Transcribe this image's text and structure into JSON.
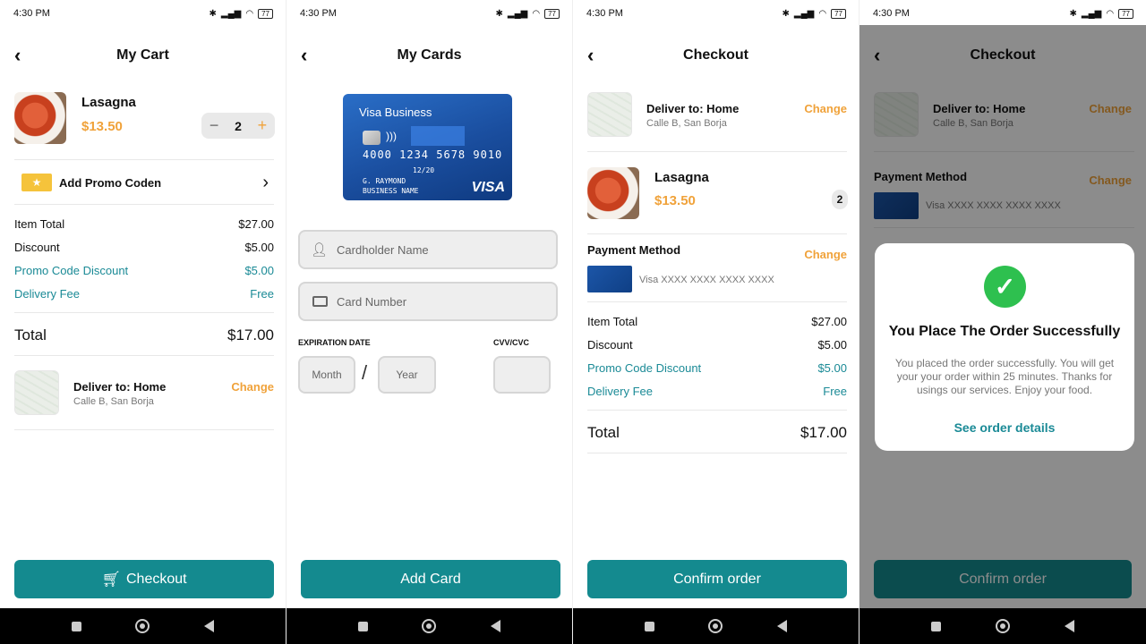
{
  "status": {
    "time": "4:30 PM",
    "battery": "77"
  },
  "cart": {
    "title": "My Cart",
    "item": {
      "name": "Lasagna",
      "price": "$13.50",
      "qty": "2"
    },
    "promo_label": "Add Promo Coden",
    "summary": [
      {
        "label": "Item Total",
        "value": "$27.00"
      },
      {
        "label": "Discount",
        "value": "$5.00"
      },
      {
        "label": "Promo Code Discount",
        "value": "$5.00"
      },
      {
        "label": "Delivery Fee",
        "value": "Free"
      }
    ],
    "total_label": "Total",
    "total_value": "$17.00",
    "deliver_title": "Deliver to: Home",
    "deliver_address": "Calle B, San Borja",
    "change": "Change",
    "checkout": "Checkout"
  },
  "cards": {
    "title": "My Cards",
    "card": {
      "brand_line": "Visa Business",
      "number": "4000 1234 5678 9010",
      "expiry": "12/20",
      "holder": "G. RAYMOND",
      "business": "BUSINESS NAME",
      "logo": "VISA"
    },
    "cardholder_placeholder": "Cardholder Name",
    "cardnumber_placeholder": "Card Number",
    "expiration_label": "EXPIRATION DATE",
    "cvv_label": "CVV/CVC",
    "month_placeholder": "Month",
    "year_placeholder": "Year",
    "slash": "/",
    "add_card": "Add Card"
  },
  "checkout": {
    "title": "Checkout",
    "deliver_title": "Deliver to: Home",
    "deliver_address": "Calle B, San Borja",
    "change": "Change",
    "item": {
      "name": "Lasagna",
      "price": "$13.50",
      "qty": "2"
    },
    "payment_title": "Payment Method",
    "payment_card": "Visa XXXX XXXX XXXX XXXX",
    "summary": [
      {
        "label": "Item Total",
        "value": "$27.00"
      },
      {
        "label": "Discount",
        "value": "$5.00"
      },
      {
        "label": "Promo Code Discount",
        "value": "$5.00"
      },
      {
        "label": "Delivery Fee",
        "value": "Free"
      }
    ],
    "total_label": "Total",
    "total_value": "$17.00",
    "confirm": "Confirm order"
  },
  "success": {
    "title": "Checkout",
    "deliver_title": "Deliver to: Home",
    "deliver_address": "Calle B, San Borja",
    "change": "Change",
    "payment_title": "Payment Method",
    "payment_card": "Visa XXXX XXXX XXXX XXXX",
    "dialog_title": "You Place The Order Successfully",
    "dialog_body": "You placed the order successfully. You will get your your order within 25 minutes. Thanks for usings our services. Enjoy your food.",
    "dialog_link": "See order details",
    "confirm": "Confirm order"
  },
  "colors": {
    "teal": "#148a8f",
    "orange": "#f0a23a",
    "success_green": "#2ec04f"
  }
}
